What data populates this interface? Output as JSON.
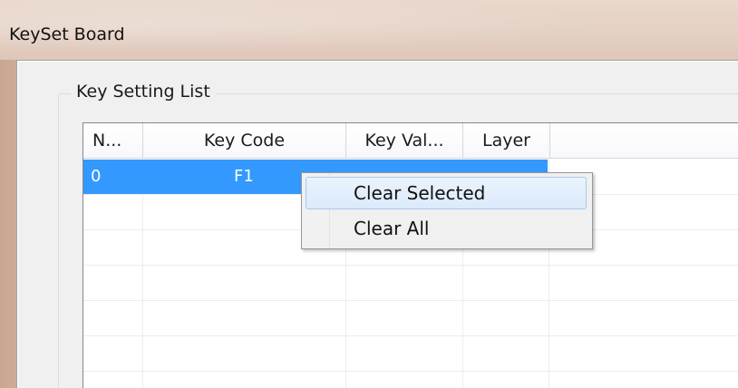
{
  "window": {
    "title": "KeySet Board"
  },
  "group": {
    "title": "Key Setting List"
  },
  "list": {
    "columns": [
      "N...",
      "Key Code",
      "Key Val...",
      "Layer"
    ],
    "rows": [
      {
        "number": "0",
        "key_code": "F1",
        "key_value": "",
        "layer": ""
      }
    ],
    "selected_row": 0
  },
  "context_menu": {
    "items": [
      "Clear Selected",
      "Clear All"
    ],
    "highlighted": "Clear Selected"
  },
  "colors": {
    "selection": "#3399ff",
    "menu_highlight_border": "#a8c8ec"
  }
}
